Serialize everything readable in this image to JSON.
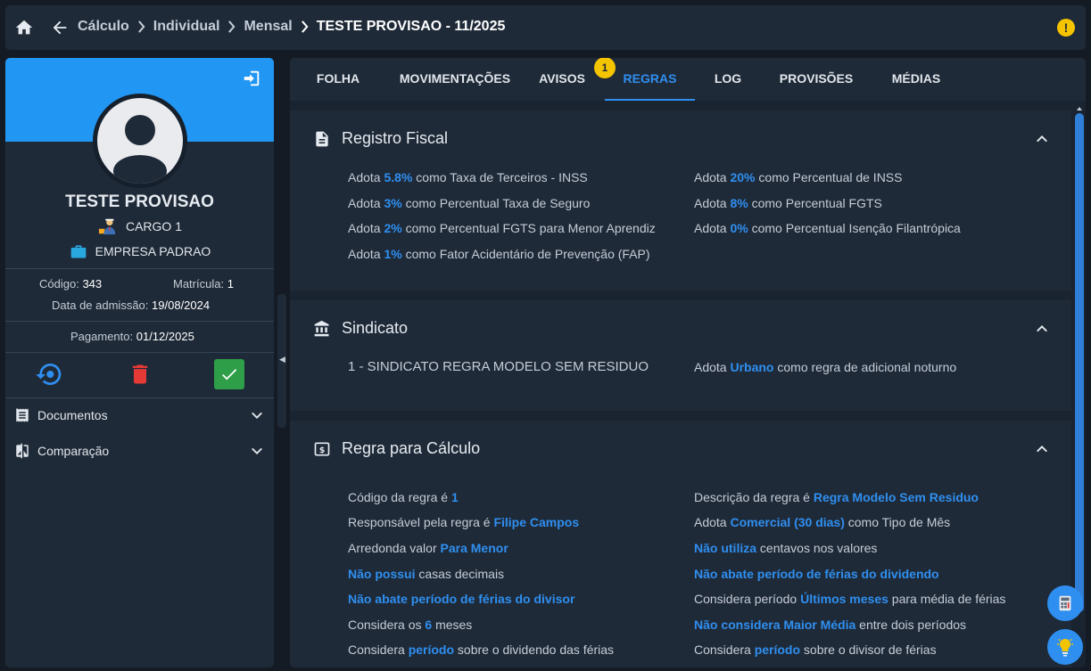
{
  "breadcrumb": {
    "items": [
      "Cálculo",
      "Individual",
      "Mensal"
    ],
    "current": "TESTE PROVISAO - 11/2025"
  },
  "alert_icon_label": "!",
  "employee": {
    "name": "TESTE PROVISAO",
    "cargo": "CARGO 1",
    "empresa": "EMPRESA PADRAO",
    "codigo_label": "Código:",
    "codigo": "343",
    "matricula_label": "Matrícula:",
    "matricula": "1",
    "admissao_label": "Data de admissão:",
    "admissao": "19/08/2024",
    "pagamento_label": "Pagamento:",
    "pagamento": "01/12/2025"
  },
  "side_menu": [
    {
      "label": "Documentos"
    },
    {
      "label": "Comparação"
    }
  ],
  "tabs": [
    {
      "label": "FOLHA"
    },
    {
      "label": "MOVIMENTAÇÕES"
    },
    {
      "label": "AVISOS"
    },
    {
      "label": "REGRAS"
    },
    {
      "label": "LOG"
    },
    {
      "label": "PROVISÕES"
    },
    {
      "label": "MÉDIAS"
    }
  ],
  "active_tab": "REGRAS",
  "avisos_badge": "1",
  "sections": {
    "fiscal": {
      "title": "Registro Fiscal",
      "rules": [
        {
          "pre": "Adota ",
          "hl": "5.8%",
          "post": " como Taxa de Terceiros - INSS"
        },
        {
          "pre": "Adota ",
          "hl": "20%",
          "post": " como Percentual de INSS"
        },
        {
          "pre": "Adota ",
          "hl": "3%",
          "post": " como Percentual Taxa de Seguro"
        },
        {
          "pre": "Adota ",
          "hl": "8%",
          "post": " como Percentual FGTS"
        },
        {
          "pre": "Adota ",
          "hl": "2%",
          "post": " como Percentual FGTS para Menor Aprendiz"
        },
        {
          "pre": "Adota ",
          "hl": "0%",
          "post": " como Percentual Isenção Filantrópica"
        },
        {
          "pre": "Adota ",
          "hl": "1%",
          "post": " como Fator Acidentário de Prevenção (FAP)"
        }
      ]
    },
    "sindicato": {
      "title": "Sindicato",
      "name": "1 - SINDICATO REGRA MODELO SEM RESIDUO",
      "rule": {
        "pre": "Adota ",
        "hl": "Urbano",
        "post": " como regra de adicional noturno"
      }
    },
    "calculo": {
      "title": "Regra para Cálculo",
      "rules": [
        {
          "pre": "Código da regra é ",
          "hl": "1",
          "post": ""
        },
        {
          "pre": "Descrição da regra é ",
          "hl": "Regra Modelo Sem Residuo",
          "post": ""
        },
        {
          "pre": "Responsável pela regra é ",
          "hl": "Filipe Campos",
          "post": ""
        },
        {
          "pre": "Adota ",
          "hl": "Comercial (30 dias)",
          "post": " como Tipo de Mês"
        },
        {
          "pre": "Arredonda valor ",
          "hl": "Para Menor",
          "post": ""
        },
        {
          "pre": "",
          "hl": "Não utiliza",
          "post": " centavos nos valores"
        },
        {
          "pre": "",
          "hl": "Não possui",
          "post": " casas decimais"
        },
        {
          "pre": "",
          "hl": "Não abate período de férias do dividendo",
          "post": ""
        },
        {
          "pre": "",
          "hl": "Não abate período de férias do divisor",
          "post": ""
        },
        {
          "pre": "Considera período ",
          "hl": "Últimos meses",
          "post": " para média de férias"
        },
        {
          "pre": "Considera os ",
          "hl": "6",
          "post": " meses"
        },
        {
          "pre": "",
          "hl": "Não considera Maior Média",
          "post": " entre dois períodos"
        },
        {
          "pre": "Considera ",
          "hl": "período",
          "post": " sobre o dividendo das férias"
        },
        {
          "pre": "Considera ",
          "hl": "período",
          "post": " sobre o divisor de férias"
        }
      ]
    }
  },
  "colors": {
    "accent": "#2f8ff0",
    "banner": "#2196f3",
    "warning": "#f4c400",
    "delete": "#e53935",
    "confirm": "#2e9e48"
  }
}
